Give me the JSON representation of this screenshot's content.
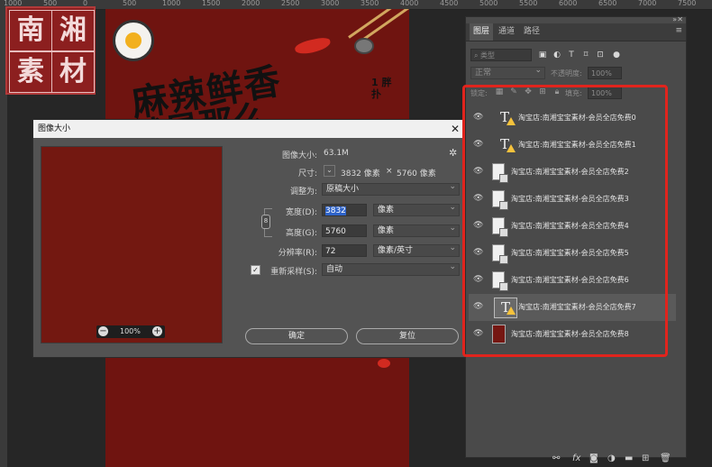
{
  "ruler": {
    "ticks": [
      "1000",
      "500",
      "0",
      "500",
      "1000",
      "1500",
      "2000",
      "2500",
      "3000",
      "3500",
      "4000",
      "4500",
      "5000",
      "5500",
      "6000",
      "6500",
      "7000",
      "7500"
    ]
  },
  "poster": {
    "logo_chars": [
      "南",
      "湘",
      "素",
      "材"
    ],
    "headline_line1": "麻辣鲜香",
    "headline_line2": "就是那么",
    "vertical_text": "1 胖 扑"
  },
  "dialog": {
    "title": "图像大小",
    "close": "✕",
    "gear": "✲",
    "image_size_label": "图像大小:",
    "image_size_value": "63.1M",
    "dimensions_label": "尺寸:",
    "dimensions_w": "3832 像素",
    "dimensions_x": "×",
    "dimensions_h": "5760 像素",
    "fit_to_label": "调整为:",
    "fit_to_value": "原稿大小",
    "width_label": "宽度(D):",
    "width_value": "3832",
    "width_unit": "像素",
    "height_label": "高度(G):",
    "height_value": "5760",
    "height_unit": "像素",
    "resolution_label": "分辨率(R):",
    "resolution_value": "72",
    "resolution_unit": "像素/英寸",
    "resample_label": "重新采样(S):",
    "resample_checked": true,
    "resample_value": "自动",
    "zoom_value": "100%",
    "zoom_minus": "−",
    "zoom_plus": "+",
    "ok_label": "确定",
    "reset_label": "复位"
  },
  "layers_panel": {
    "tabs": [
      "图层",
      "通道",
      "路径"
    ],
    "active_tab": "图层",
    "filter_placeholder": "类型",
    "blend_mode": "正常",
    "opacity_label": "不透明度:",
    "opacity_value": "100%",
    "lock_label": "锁定:",
    "fill_label": "填充:",
    "fill_value": "100%",
    "layers": [
      {
        "name": "淘宝店:南湘宝宝素材-会员全店免费0",
        "type": "text",
        "warning": true,
        "selected": false
      },
      {
        "name": "淘宝店:南湘宝宝素材-会员全店免费1",
        "type": "text",
        "warning": true,
        "selected": false
      },
      {
        "name": "淘宝店:南湘宝宝素材-会员全店免费2",
        "type": "smart",
        "warning": false,
        "selected": false
      },
      {
        "name": "淘宝店:南湘宝宝素材-会员全店免费3",
        "type": "smart",
        "warning": false,
        "selected": false
      },
      {
        "name": "淘宝店:南湘宝宝素材-会员全店免费4",
        "type": "smart",
        "warning": false,
        "selected": false
      },
      {
        "name": "淘宝店:南湘宝宝素材-会员全店免费5",
        "type": "smart",
        "warning": false,
        "selected": false
      },
      {
        "name": "淘宝店:南湘宝宝素材-会员全店免费6",
        "type": "smart",
        "warning": false,
        "selected": false
      },
      {
        "name": "淘宝店:南湘宝宝素材-会员全店免费7",
        "type": "text",
        "warning": true,
        "selected": true
      },
      {
        "name": "淘宝店:南湘宝宝素材-会员全店免费8",
        "type": "fill",
        "warning": false,
        "selected": false
      }
    ],
    "footer_icons": [
      "link-icon",
      "fx-icon",
      "mask-icon",
      "adjustment-icon",
      "folder-icon",
      "new-layer-icon",
      "trash-icon"
    ],
    "highlight_color": "#e1241d"
  }
}
